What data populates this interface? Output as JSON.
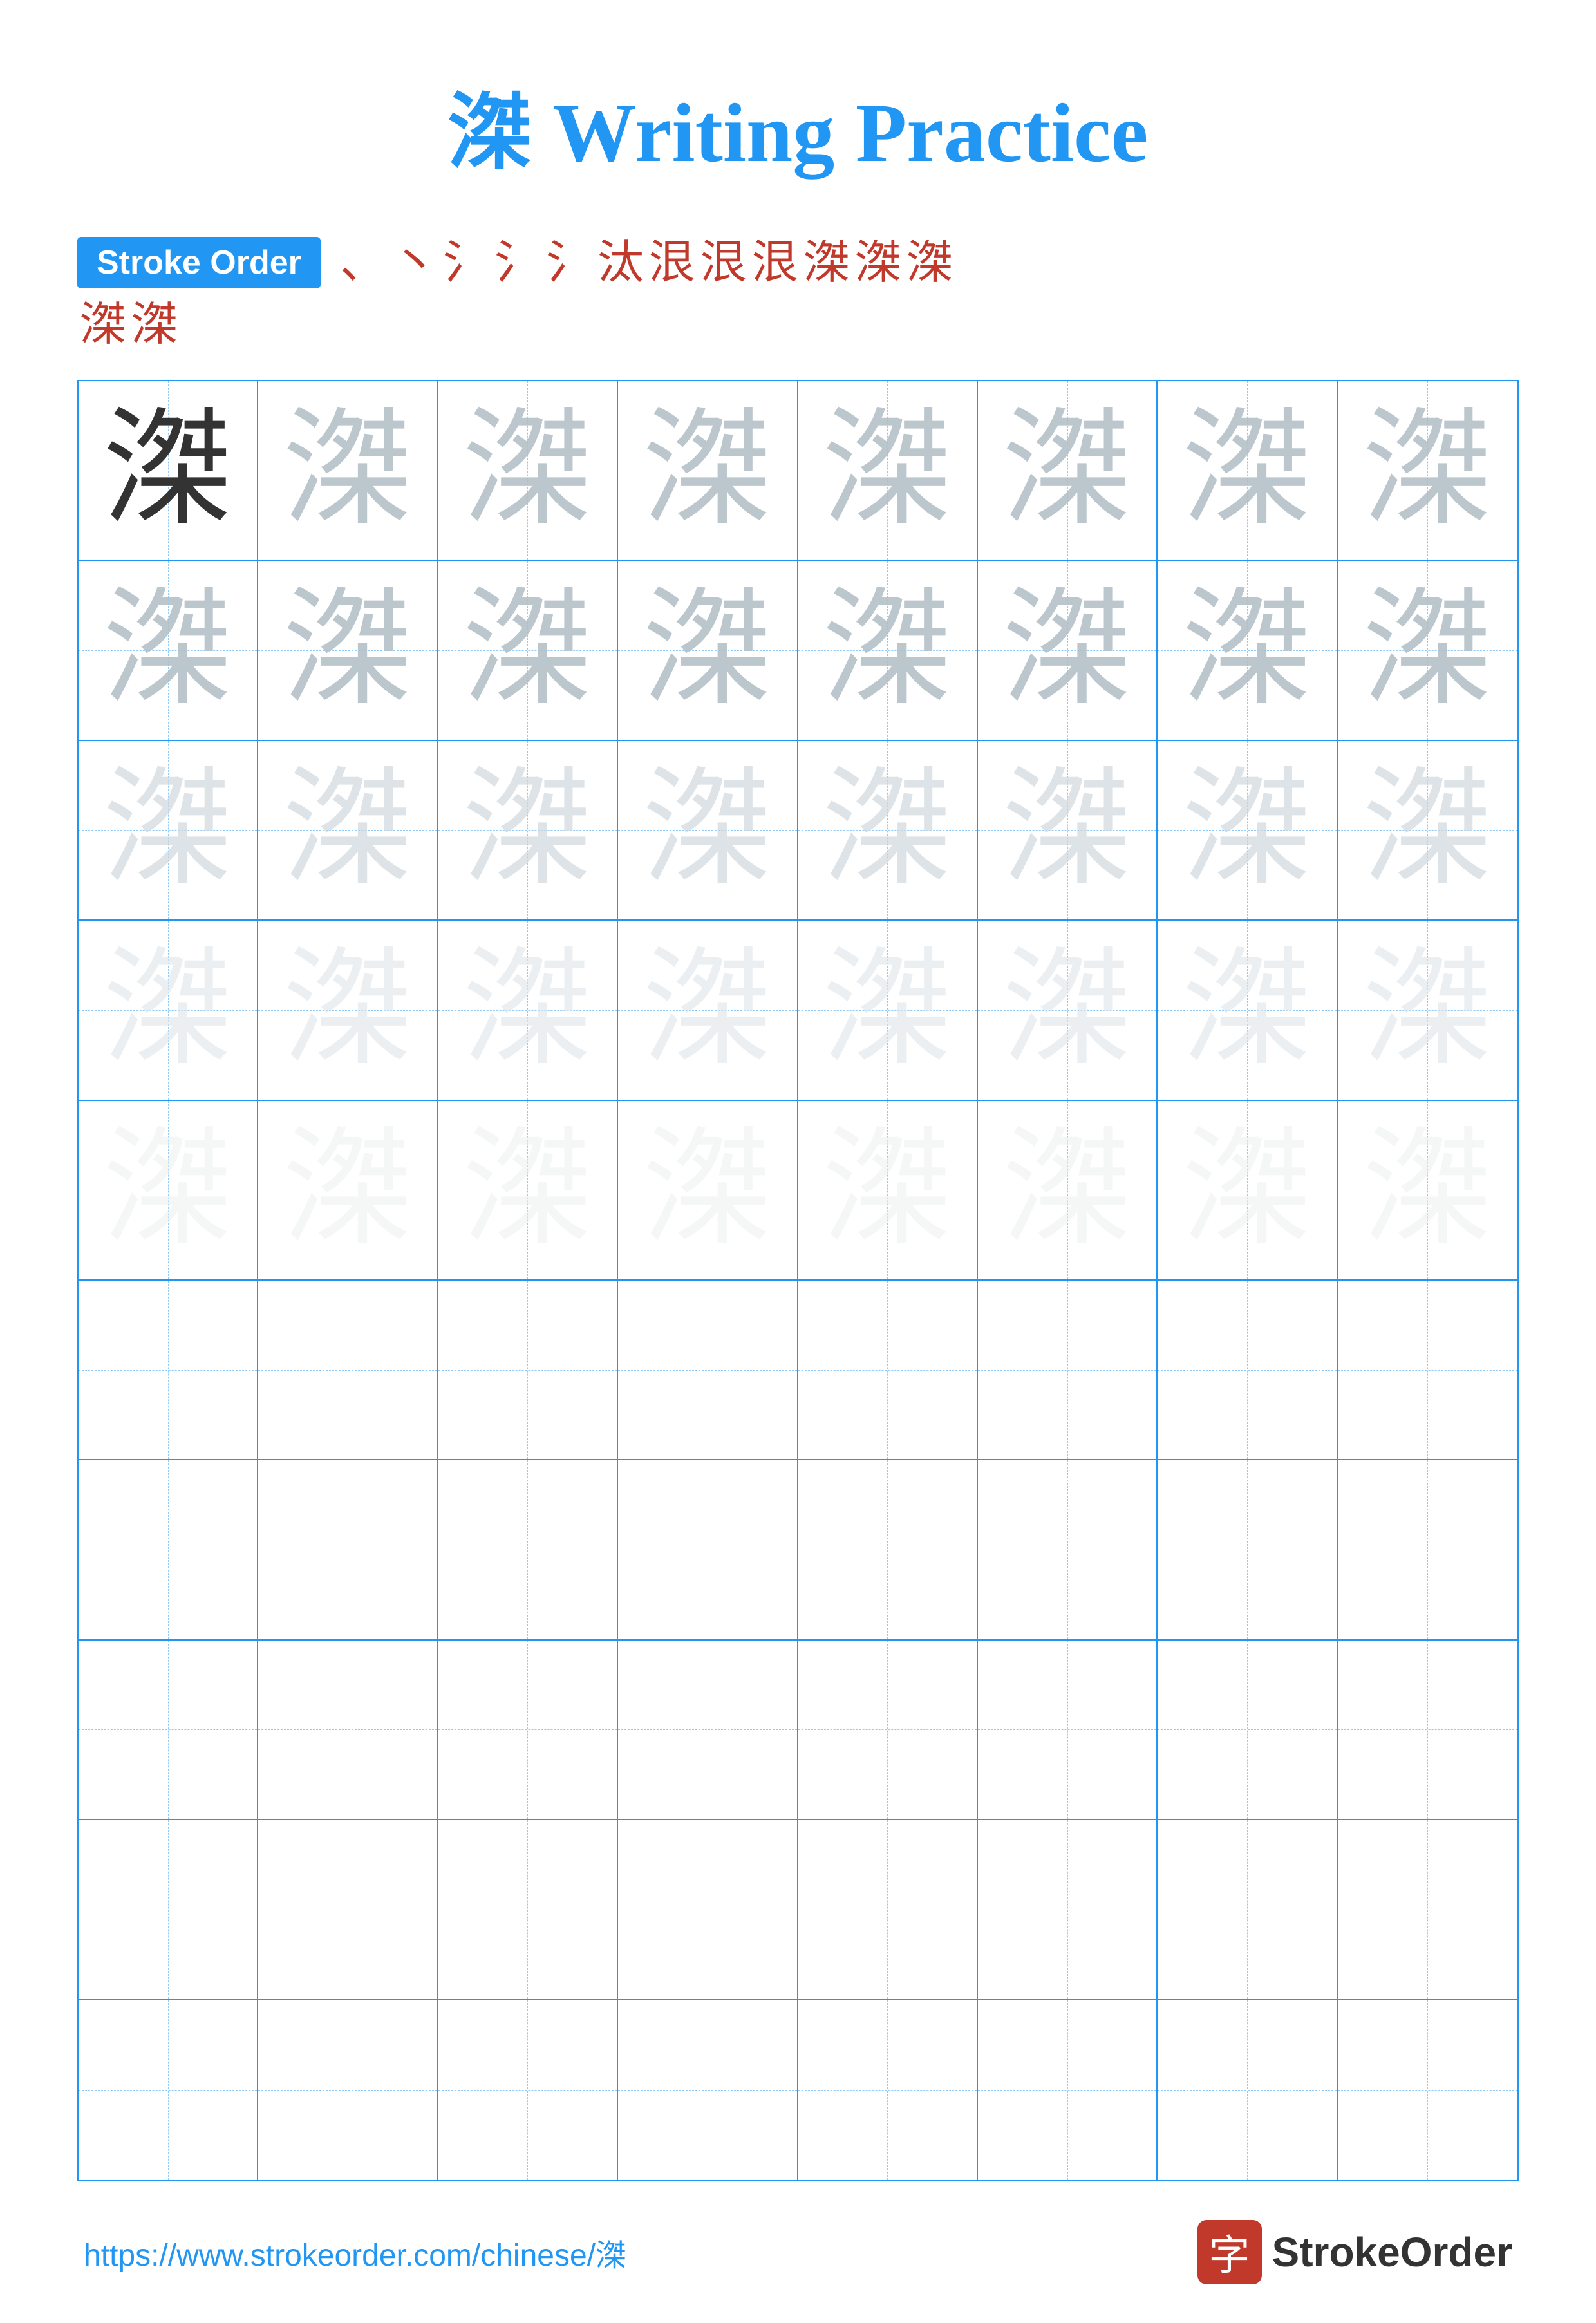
{
  "title": "滐 Writing Practice",
  "stroke_order": {
    "badge_label": "Stroke Order",
    "strokes_line1": [
      "、",
      "丶",
      "氵",
      "氵",
      "氵",
      "汰",
      "泿",
      "泿",
      "泿",
      "滐",
      "滐",
      "滐"
    ],
    "strokes_line2": [
      "滐",
      "滐"
    ]
  },
  "character": "滐",
  "grid": {
    "rows": 10,
    "cols": 8,
    "practice_rows": 5,
    "blank_rows": 5
  },
  "footer": {
    "url": "https://www.strokeorder.com/chinese/滐",
    "logo_icon": "字",
    "logo_text": "StrokeOrder"
  },
  "colors": {
    "primary": "#2196F3",
    "accent": "#c0392b",
    "dark_char": "#333333",
    "light1": "#b0bec5",
    "light2": "#cfd8dc",
    "light3": "#e0e6ea",
    "light4": "#ecf0f1"
  }
}
